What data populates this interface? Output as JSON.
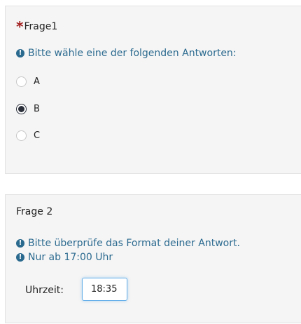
{
  "question1": {
    "required_mark": "*",
    "title": "Frage1",
    "tip": "Bitte wähle eine der folgenden Antworten:",
    "tip_icon": "exclamation-circle-icon",
    "options": [
      {
        "label": "A",
        "checked": false
      },
      {
        "label": "B",
        "checked": true
      },
      {
        "label": "C",
        "checked": false
      }
    ]
  },
  "question2": {
    "title": "Frage 2",
    "tip1": "Bitte überprüfe das Format deiner Antwort.",
    "tip2": "Nur ab 17:00 Uhr",
    "tip_icon": "exclamation-circle-icon",
    "time_label": "Uhrzeit:",
    "time_value": "18:35"
  },
  "colors": {
    "tip": "#2b6a8f",
    "required": "#a32020",
    "card_bg": "#f5f5f5",
    "input_focus": "#66afe9"
  }
}
